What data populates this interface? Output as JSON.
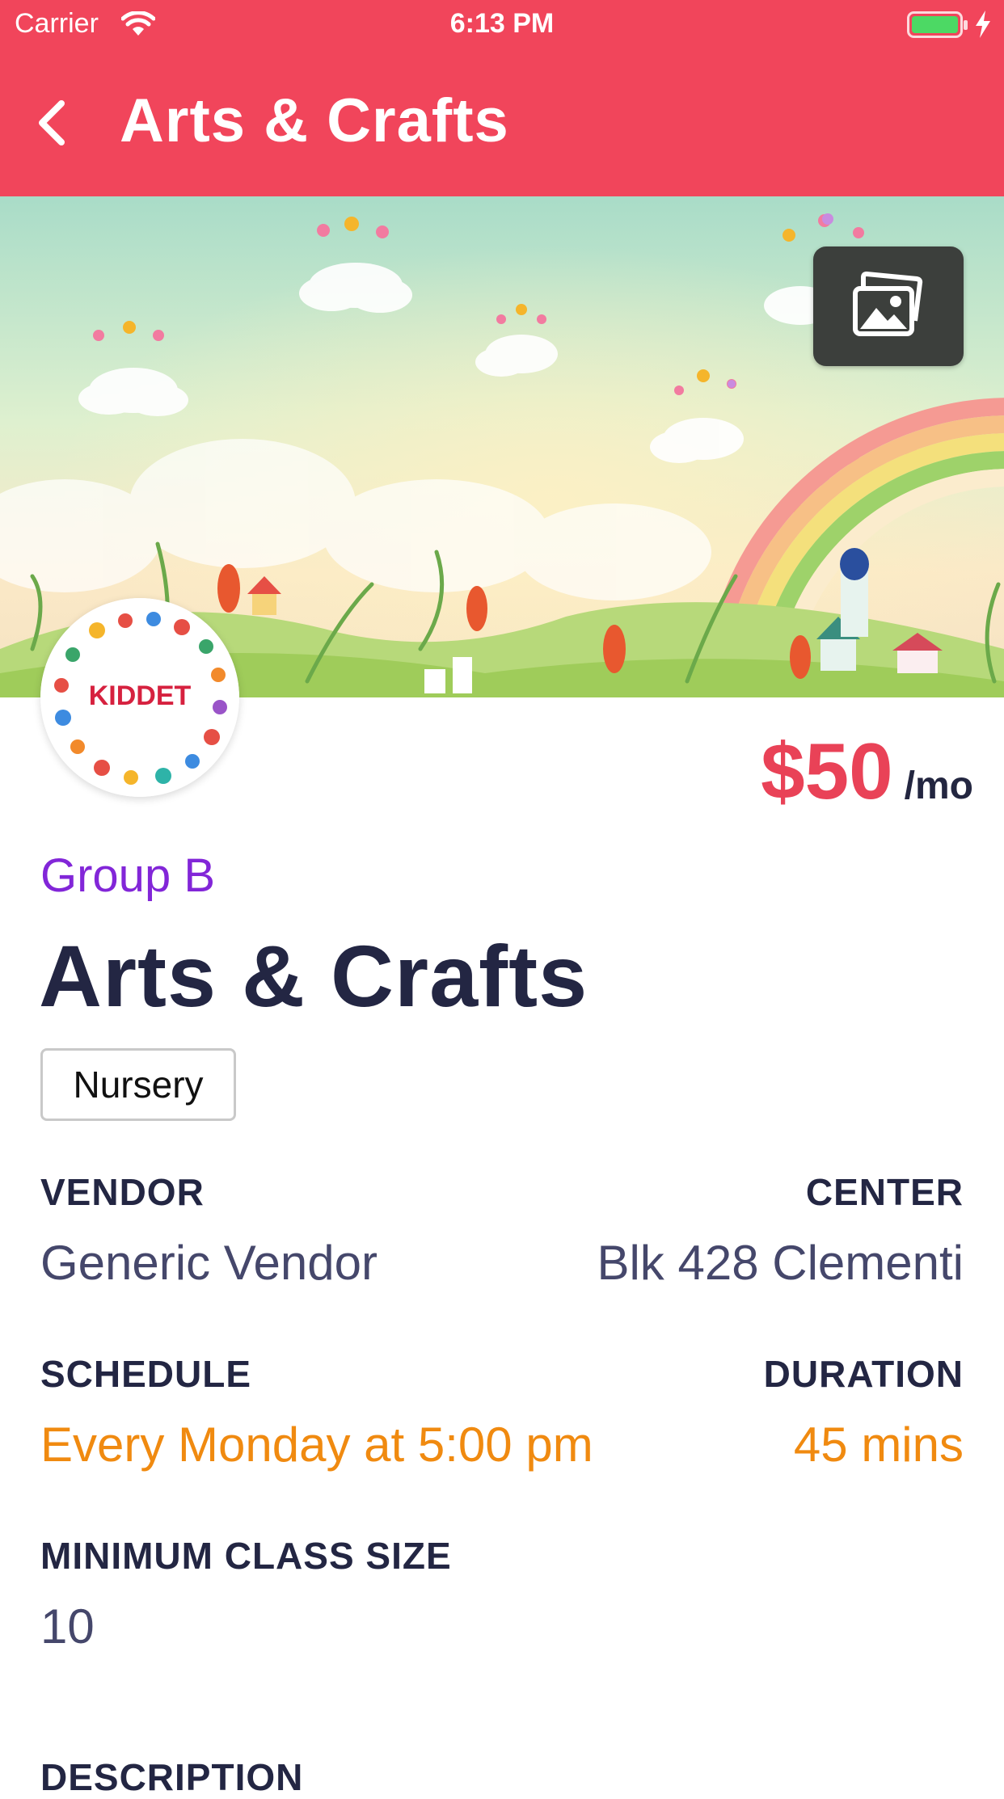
{
  "status_bar": {
    "carrier": "Carrier",
    "time": "6:13 PM"
  },
  "nav": {
    "back_icon": "chevron-left-icon",
    "title": "Arts & Crafts"
  },
  "hero": {
    "gallery_icon": "photo-gallery-icon"
  },
  "logo": {
    "text": "KIDDET"
  },
  "price": {
    "amount": "$50",
    "unit": "/mo"
  },
  "group": "Group B",
  "title": "Arts & Crafts",
  "tag": "Nursery",
  "details": {
    "vendor_label": "VENDOR",
    "vendor_value": "Generic Vendor",
    "center_label": "CENTER",
    "center_value": "Blk 428 Clementi",
    "schedule_label": "SCHEDULE",
    "schedule_value": "Every Monday at 5:00 pm",
    "duration_label": "DURATION",
    "duration_value": "45 mins",
    "min_size_label": "MINIMUM CLASS SIZE",
    "min_size_value": "10",
    "description_label": "DESCRIPTION"
  },
  "colors": {
    "brand": "#f1455b",
    "price": "#e94257",
    "group": "#8226d8",
    "accent_orange": "#f08a10",
    "heading": "#232643",
    "value": "#45476b"
  }
}
